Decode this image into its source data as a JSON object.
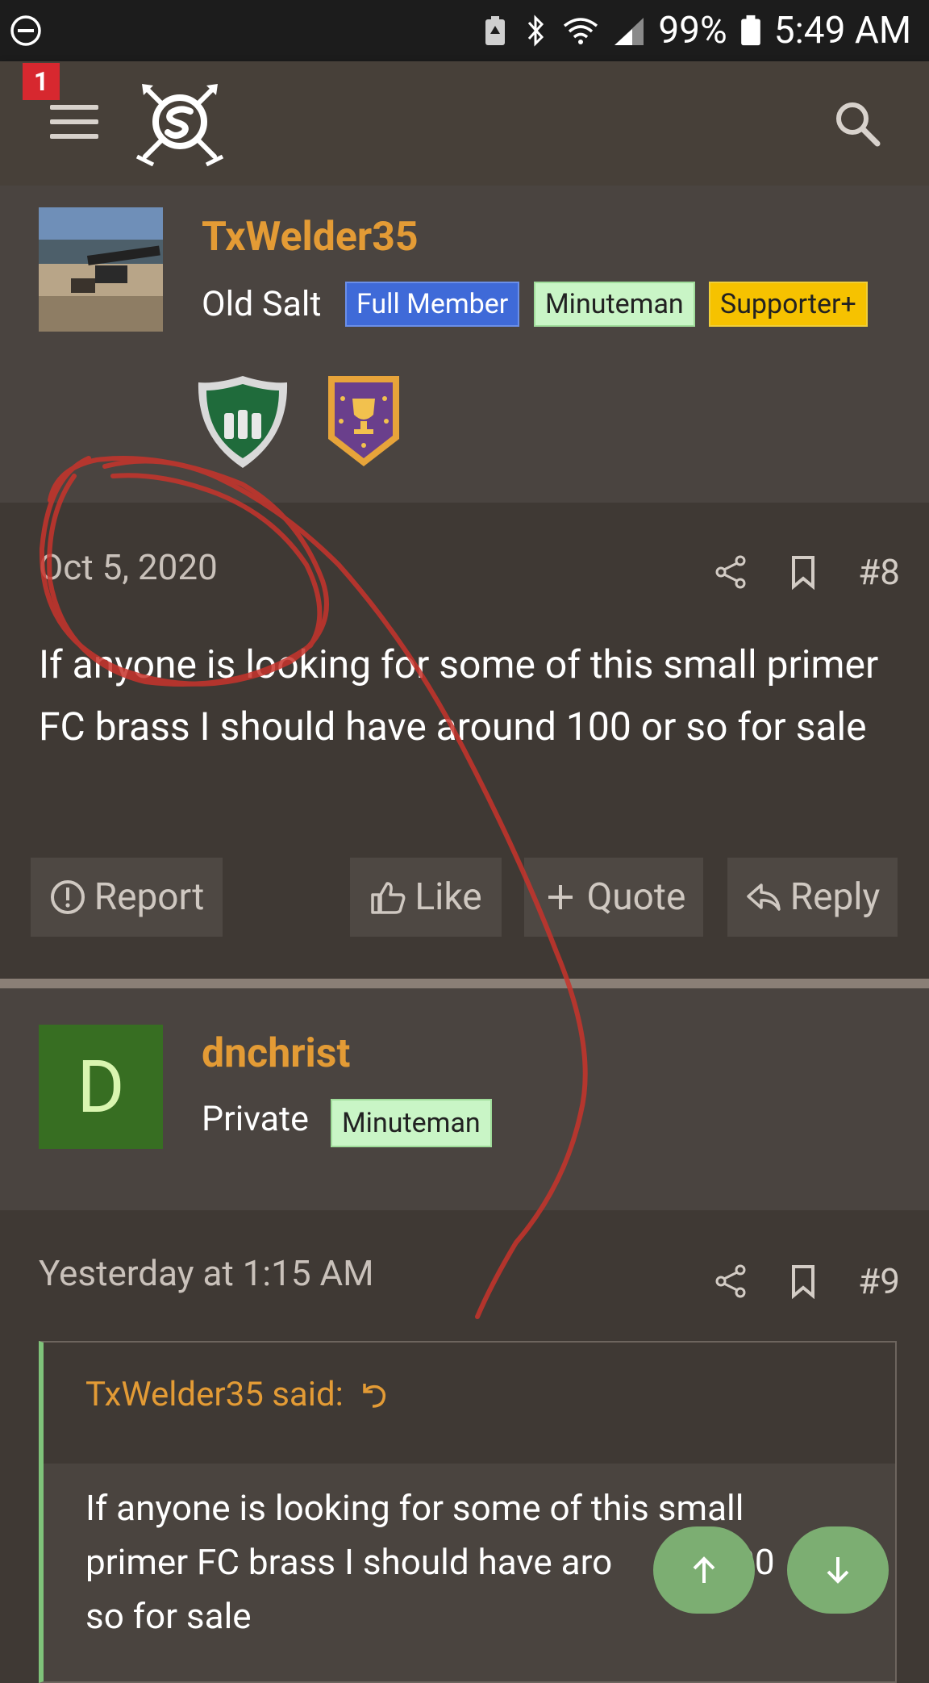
{
  "status_bar": {
    "battery": "99%",
    "time": "5:49 AM"
  },
  "navbar": {
    "notification_count": "1"
  },
  "posts": [
    {
      "author": "TxWelder35",
      "title": "Old Salt",
      "badges": [
        "Full Member",
        "Minuteman",
        "Supporter+"
      ],
      "date": "Oct 5, 2020",
      "number": "#8",
      "text": "If anyone is looking for some of this small primer FC brass I should have around 100 or so for sale"
    },
    {
      "author": "dnchrist",
      "avatar_letter": "D",
      "title": "Private",
      "badges": [
        "Minuteman"
      ],
      "date": "Yesterday at 1:15 AM",
      "number": "#9",
      "quote_author": "TxWelder35 said:",
      "quote_lines": [
        "If anyone is looking for some of this small",
        "primer FC brass I should have aro",
        "so for sale"
      ],
      "quote_fragment": "00"
    }
  ],
  "post_actions": {
    "report": "Report",
    "like": "Like",
    "quote": "Quote",
    "reply": "Reply"
  },
  "colors": {
    "username": "#e39b35",
    "annotation": "#c8342c",
    "fab": "#7cae72"
  }
}
